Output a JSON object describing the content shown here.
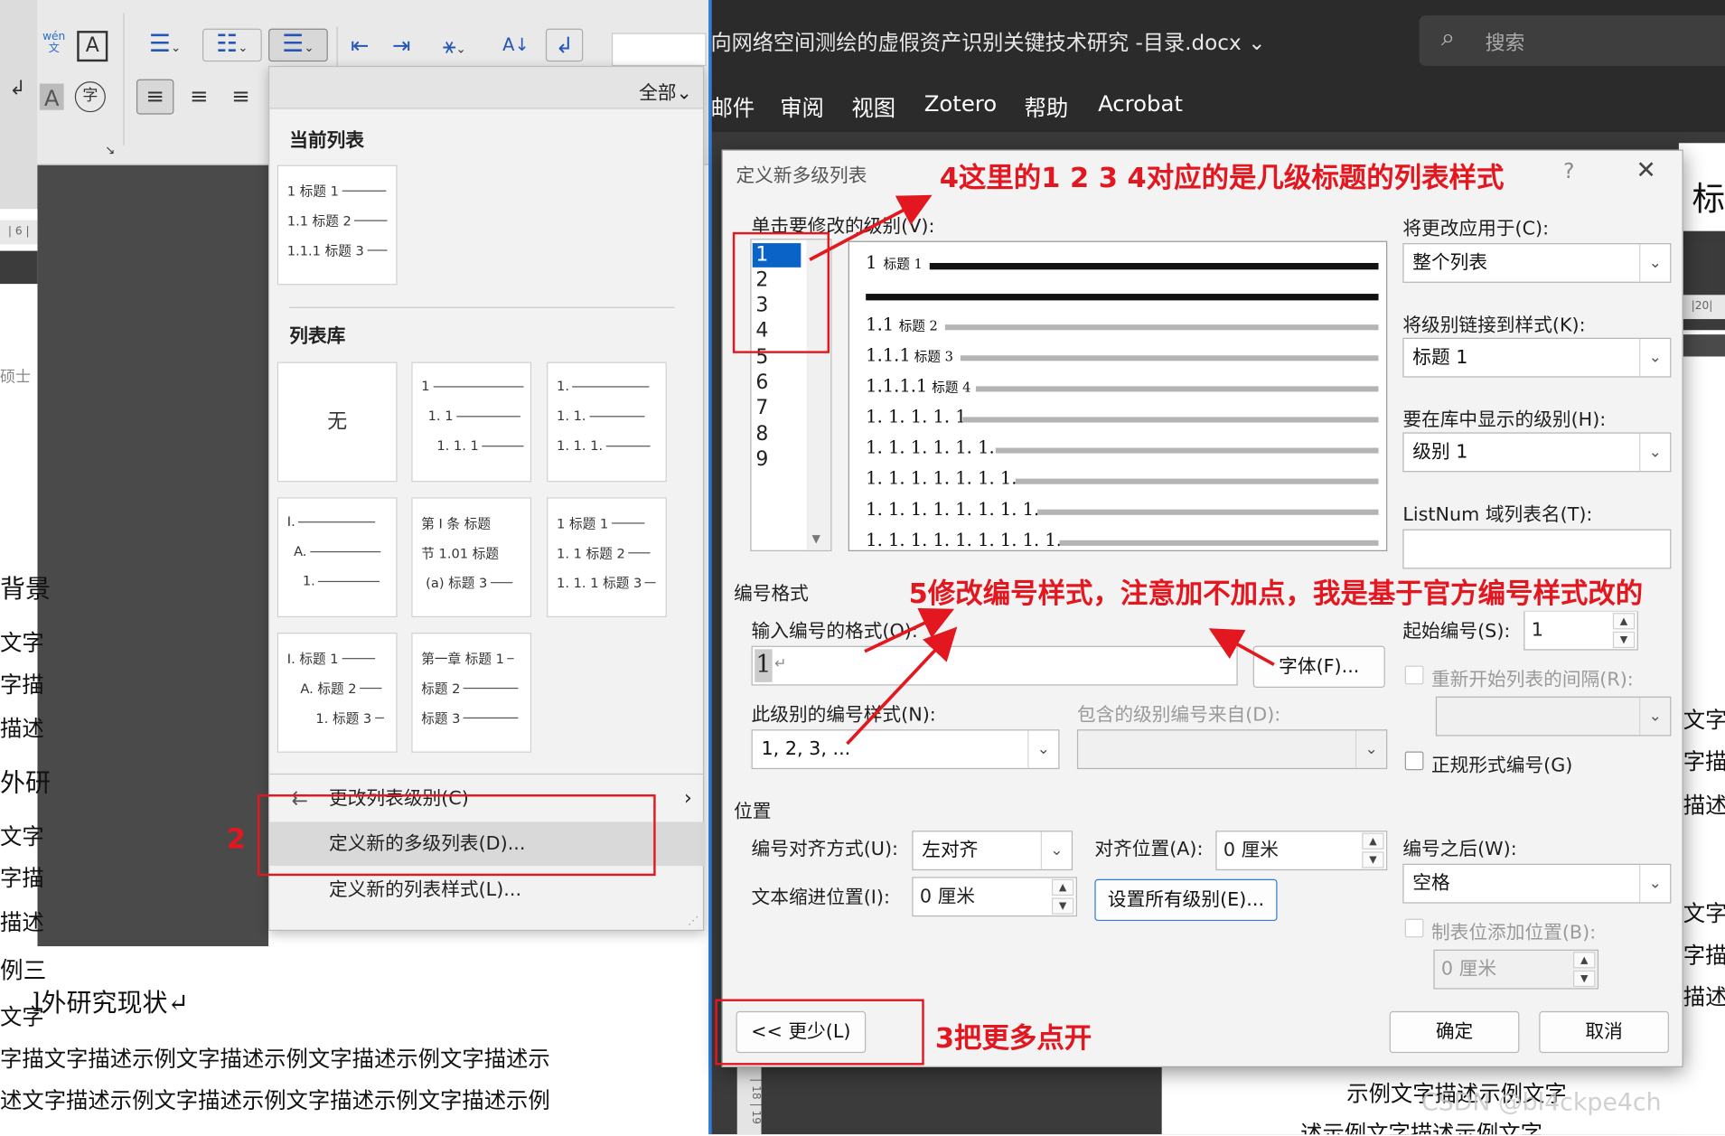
{
  "left_ribbon": {
    "wen_label": "wén\n文",
    "tool_icons": [
      "phonetic-guide-icon",
      "character-border-icon",
      "bullets-icon",
      "numbering-icon",
      "multilevel-list-icon",
      "decrease-indent-icon",
      "increase-indent-icon",
      "chinese-layout-icon",
      "sort-icon",
      "show-marks-icon"
    ]
  },
  "left_doc": {
    "lines": [
      "背景",
      "文字",
      "字描",
      "描述",
      "外研",
      "文字",
      "字描",
      "描述",
      "例三",
      "l外研究现状↵",
      "文字",
      "字描文字描述示例文字描述示例文字描述示例文字描述示",
      "述文字描述示例文字描述示例文字描述示例文字描述示例"
    ],
    "ruler_marks": [
      "6",
      "18",
      "19"
    ],
    "side_text": "硕士"
  },
  "gallery": {
    "filter": "全部",
    "current_header": "当前列表",
    "library_header": "列表库",
    "current_card": [
      "1 标题 1",
      "1.1 标题 2",
      "1.1.1 标题 3"
    ],
    "cards": [
      {
        "type": "none",
        "label": "无"
      },
      {
        "lines": [
          "1",
          "1. 1",
          "1. 1. 1"
        ]
      },
      {
        "lines": [
          "1.",
          "1. 1.",
          "1. 1. 1."
        ]
      },
      {
        "lines": [
          "I.",
          "A.",
          "1."
        ]
      },
      {
        "lines": [
          "第 I 条 标题",
          "节 1.01 标题",
          "(a) 标题 3"
        ]
      },
      {
        "lines": [
          "1 标题 1",
          "1. 1 标题 2",
          "1. 1. 1 标题 3"
        ]
      },
      {
        "lines": [
          "I. 标题 1",
          "A. 标题 2",
          "1. 标题 3"
        ]
      },
      {
        "lines": [
          "第一章 标题 1",
          "标题 2",
          "标题 3"
        ]
      }
    ],
    "menu": [
      "更改列表级别(C)",
      "定义新的多级列表(D)...",
      "定义新的列表样式(L)..."
    ]
  },
  "right_window": {
    "title": "向网络空间测绘的虚假资产识别关键技术研究 -目录.docx",
    "search_placeholder": "搜索",
    "menu": [
      "邮件",
      "审阅",
      "视图",
      "Zotero",
      "帮助",
      "Acrobat"
    ],
    "doc_heading_char": "标",
    "doc_lines": [
      "文字",
      "字描",
      "描述示",
      "文字",
      "字描",
      "描述示"
    ],
    "doc_bottom": [
      "示例文字描述示例文字",
      "述示例文字描述示例文字"
    ],
    "ruler_mark": "20",
    "watermark": "CSDN @bl4ckpe4ch"
  },
  "dialog": {
    "title": "定义新多级列表",
    "help": "?",
    "close": "✕",
    "level_label": "单击要修改的级别(V):",
    "levels": [
      "1",
      "2",
      "3",
      "4",
      "5",
      "6",
      "7",
      "8",
      "9"
    ],
    "selected_level": "1",
    "preview": [
      {
        "num": "1",
        "label": "标题 1"
      },
      {
        "num": "1.1",
        "label": "标题 2"
      },
      {
        "num": "1.1.1",
        "label": "标题 3"
      },
      {
        "num": "1.1.1.1",
        "label": "标题 4"
      },
      {
        "num": "1. 1. 1. 1. 1",
        "label": ""
      },
      {
        "num": "1. 1. 1. 1. 1. 1.",
        "label": ""
      },
      {
        "num": "1. 1. 1. 1. 1. 1. 1.",
        "label": ""
      },
      {
        "num": "1. 1. 1. 1. 1. 1. 1. 1.",
        "label": ""
      },
      {
        "num": "1. 1. 1. 1. 1. 1. 1. 1. 1.",
        "label": ""
      }
    ],
    "apply_to_label": "将更改应用于(C):",
    "apply_to_value": "整个列表",
    "link_style_label": "将级别链接到样式(K):",
    "link_style_value": "标题 1",
    "gallery_level_label": "要在库中显示的级别(H):",
    "gallery_level_value": "级别 1",
    "listnum_label": "ListNum 域列表名(T):",
    "listnum_value": "",
    "number_format_section": "编号格式",
    "enter_format_label": "输入编号的格式(O):",
    "enter_format_value": "1",
    "font_button": "字体(F)...",
    "number_style_label": "此级别的编号样式(N):",
    "number_style_value": "1, 2, 3, ...",
    "include_level_label": "包含的级别编号来自(D):",
    "start_at_label": "起始编号(S):",
    "start_at_value": "1",
    "restart_label": "重新开始列表的间隔(R):",
    "legal_label": "正规形式编号(G)",
    "position_section": "位置",
    "alignment_label": "编号对齐方式(U):",
    "alignment_value": "左对齐",
    "aligned_at_label": "对齐位置(A):",
    "aligned_at_value": "0 厘米",
    "indent_label": "文本缩进位置(I):",
    "indent_value": "0 厘米",
    "set_all_button": "设置所有级别(E)...",
    "follow_label": "编号之后(W):",
    "follow_value": "空格",
    "tab_add_label": "制表位添加位置(B):",
    "tab_add_value": "0 厘米",
    "less_button": "<< 更少(L)",
    "ok_button": "确定",
    "cancel_button": "取消"
  },
  "annotations": {
    "a2": "2",
    "a3": "3把更多点开",
    "a4": "4这里的1 2 3 4对应的是几级标题的列表样式",
    "a5": "5修改编号样式，注意加不加点，我是基于官方编号样式改的"
  },
  "colors": {
    "annotation_red": "#e3171f",
    "selection_blue": "#0a64c8",
    "dark_titlebar": "#2b2b2b"
  }
}
